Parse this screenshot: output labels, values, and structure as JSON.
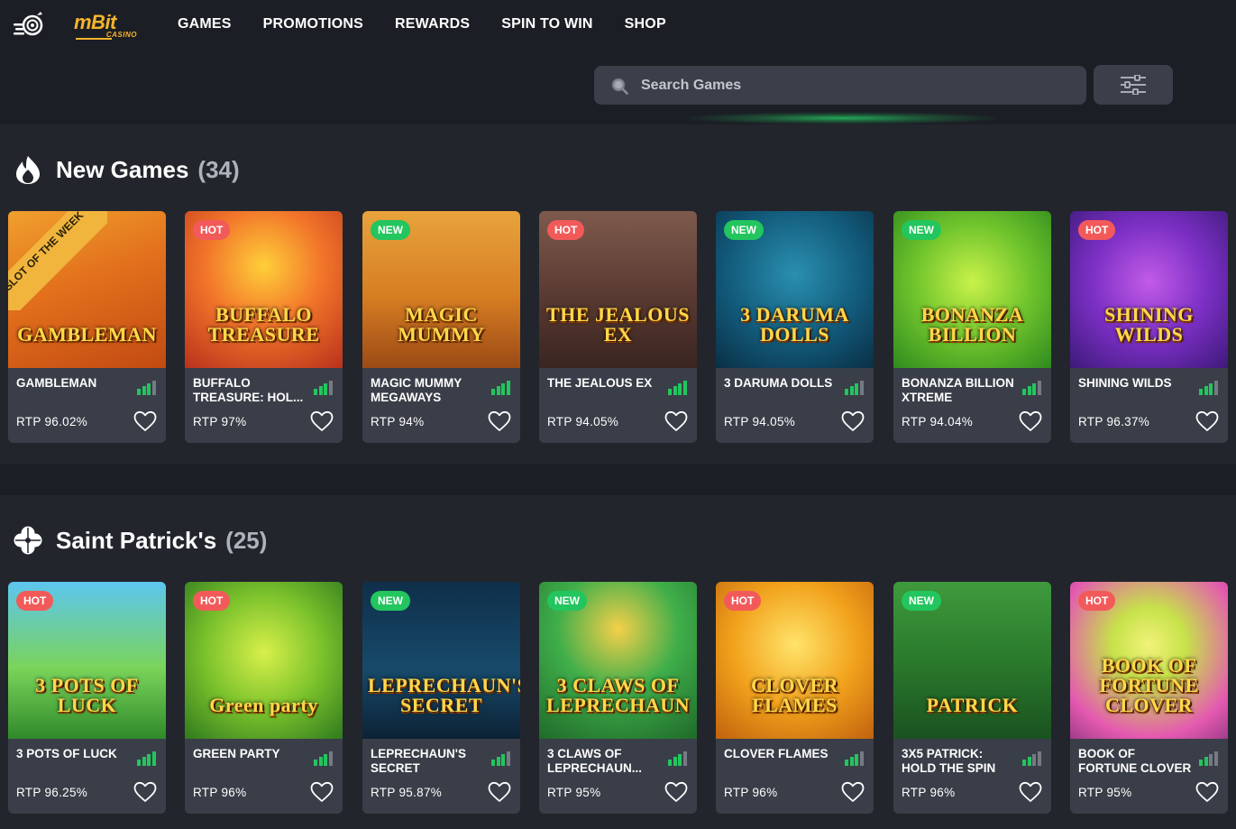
{
  "brand": {
    "name": "mBit",
    "sub": "CASINO",
    "color": "#f7b42c"
  },
  "nav": [
    "GAMES",
    "PROMOTIONS",
    "REWARDS",
    "SPIN TO WIN",
    "SHOP"
  ],
  "search": {
    "placeholder": "Search Games",
    "value": ""
  },
  "colors": {
    "hot": "#f25a5a",
    "new": "#23c55e",
    "card": "#3a3e48",
    "background": "#22252c",
    "header": "#1b1e24"
  },
  "sections": [
    {
      "title": "New Games",
      "count": "(34)",
      "icon": "flame-icon",
      "games": [
        {
          "name": "GAMBLEMAN",
          "rtp": "RTP 96.02%",
          "badge": "",
          "ribbon": "SLOT OF THE WEEK",
          "thumb_title": "GAMBLEMAN",
          "volatility": 3,
          "bg": "linear-gradient(160deg,#f0a02e 0%,#e2701c 45%,#c24a12 100%)"
        },
        {
          "name": "BUFFALO TREASURE: HOL...",
          "rtp": "RTP 97%",
          "badge": "HOT",
          "ribbon": "",
          "thumb_title": "BUFFALO TREASURE",
          "volatility": 3,
          "bg": "radial-gradient(circle at 50% 35%,#ffcf3a 0%,#f2762a 45%,#b8321c 100%)"
        },
        {
          "name": "MAGIC MUMMY MEGAWAYS",
          "rtp": "RTP 94%",
          "badge": "NEW",
          "ribbon": "",
          "thumb_title": "MAGIC MUMMY",
          "volatility": 4,
          "bg": "linear-gradient(180deg,#e8a33c 0%,#d67d22 55%,#9c4a16 100%)"
        },
        {
          "name": "THE JEALOUS EX",
          "rtp": "RTP 94.05%",
          "badge": "HOT",
          "ribbon": "",
          "thumb_title": "THE JEALOUS EX",
          "volatility": 4,
          "bg": "linear-gradient(180deg,#7d5a4c 0%,#5c3c34 50%,#3a2520 100%)"
        },
        {
          "name": "3 DARUMA DOLLS",
          "rtp": "RTP 94.05%",
          "badge": "NEW",
          "ribbon": "",
          "thumb_title": "3 DARUMA DOLLS",
          "volatility": 3,
          "bg": "radial-gradient(circle at 50% 40%,#2a8fb0 0%,#125a7a 55%,#0a2f45 100%)"
        },
        {
          "name": "BONANZA BILLION XTREME",
          "rtp": "RTP 94.04%",
          "badge": "NEW",
          "ribbon": "",
          "thumb_title": "BONANZA BILLION",
          "volatility": 3,
          "bg": "radial-gradient(circle at 50% 45%,#c9f24a 0%,#6fc42c 50%,#2f8a1e 100%)"
        },
        {
          "name": "SHINING WILDS",
          "rtp": "RTP 96.37%",
          "badge": "HOT",
          "ribbon": "",
          "thumb_title": "SHINING WILDS",
          "volatility": 3,
          "bg": "radial-gradient(circle at 50% 45%,#c25be8 0%,#7b2fc4 50%,#3e1a7a 100%)"
        }
      ]
    },
    {
      "title": "Saint Patrick's",
      "count": "(25)",
      "icon": "clover-icon",
      "games": [
        {
          "name": "3 POTS OF LUCK",
          "rtp": "RTP 96.25%",
          "badge": "HOT",
          "ribbon": "",
          "thumb_title": "3 POTS OF LUCK",
          "volatility": 4,
          "bg": "linear-gradient(180deg,#5cc6f0 0%,#7ad45a 55%,#2f8a2a 100%)"
        },
        {
          "name": "GREEN PARTY",
          "rtp": "RTP 96%",
          "badge": "HOT",
          "ribbon": "",
          "thumb_title": "Green party",
          "volatility": 3,
          "bg": "radial-gradient(circle at 50% 45%,#d8f04a 0%,#7cc22c 50%,#2f7a1e 100%)"
        },
        {
          "name": "LEPRECHAUN'S SECRET",
          "rtp": "RTP 95.87%",
          "badge": "NEW",
          "ribbon": "",
          "thumb_title": "LEPRECHAUN'S SECRET",
          "volatility": 3,
          "bg": "linear-gradient(180deg,#0f2f4a 0%,#174a6a 55%,#0c2235 100%)"
        },
        {
          "name": "3 CLAWS OF LEPRECHAUN...",
          "rtp": "RTP 95%",
          "badge": "NEW",
          "ribbon": "",
          "thumb_title": "3 CLAWS OF LEPRECHAUN",
          "volatility": 3,
          "bg": "radial-gradient(circle at 50% 30%,#f5d04a 0%,#3fae4a 45%,#1f6a2a 100%)"
        },
        {
          "name": "CLOVER FLAMES",
          "rtp": "RTP 96%",
          "badge": "HOT",
          "ribbon": "",
          "thumb_title": "CLOVER FLAMES",
          "volatility": 3,
          "bg": "radial-gradient(circle at 50% 40%,#ffe46a 0%,#f2a21c 50%,#c0620e 100%)"
        },
        {
          "name": "3X5 PATRICK: HOLD THE SPIN",
          "rtp": "RTP 96%",
          "badge": "NEW",
          "ribbon": "",
          "thumb_title": "PATRICK",
          "volatility": 2,
          "bg": "linear-gradient(180deg,#3f9a3c 0%,#2a7a2c 50%,#1a5220 100%)"
        },
        {
          "name": "BOOK OF FORTUNE CLOVER",
          "rtp": "RTP 95%",
          "badge": "HOT",
          "ribbon": "",
          "thumb_title": "BOOK OF FORTUNE CLOVER",
          "volatility": 2,
          "bg": "radial-gradient(circle at 50% 40%,#f2f27a 0%,#c7e24a 30%,#e45ab0 75%,#a03c8a 100%)"
        }
      ]
    }
  ]
}
